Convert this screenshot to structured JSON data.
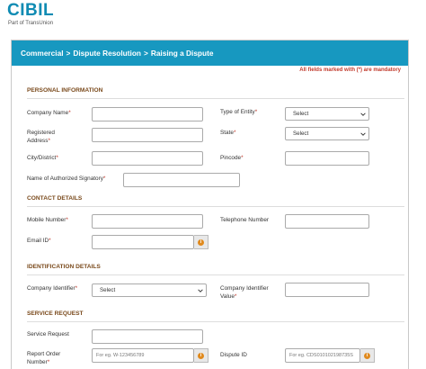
{
  "logo": {
    "brand": "CIBIL",
    "tagline": "Part of TransUnion"
  },
  "breadcrumb": {
    "items": [
      "Commercial",
      "Dispute Resolution",
      "Raising a Dispute"
    ],
    "separator": ">"
  },
  "mandatory_note": "All fields marked with (*) are mandatory",
  "sections": {
    "personal": "PERSONAL INFORMATION",
    "contact": "CONTACT DETAILS",
    "identification": "IDENTIFICATION DETAILS",
    "service": "SERVICE REQUEST"
  },
  "fields": {
    "company_name": "Company Name",
    "type_of_entity": "Type of Entity",
    "type_of_entity_value": "Select",
    "registered_address_1": "Registered",
    "registered_address_2": "Address",
    "state": "State",
    "state_value": "Select",
    "city": "City/District",
    "pincode": "Pincode",
    "authorized_signatory": "Name of Authorized Signatory",
    "mobile": "Mobile Number",
    "telephone": "Telephone Number",
    "email": "Email ID",
    "company_identifier": "Company Identifier",
    "company_identifier_value": "Select",
    "company_identifier_value_label_1": "Company Identifier",
    "company_identifier_value_label_2": "Value",
    "service_request": "Service Request",
    "report_order_1": "Report Order",
    "report_order_2": "Number",
    "report_order_placeholder": "For eg. W-123456789",
    "dispute_id": "Dispute ID",
    "dispute_id_placeholder": "For eg. CDS010102198735S"
  },
  "required_marker": "*",
  "colors": {
    "brand": "#0f8bb3",
    "bar": "#1798c0",
    "section": "#7a4a1c",
    "required": "#c0392b",
    "info": "#e08a1e"
  },
  "icons": {
    "info": "info-icon",
    "dropdown": "chevron-down-icon"
  }
}
